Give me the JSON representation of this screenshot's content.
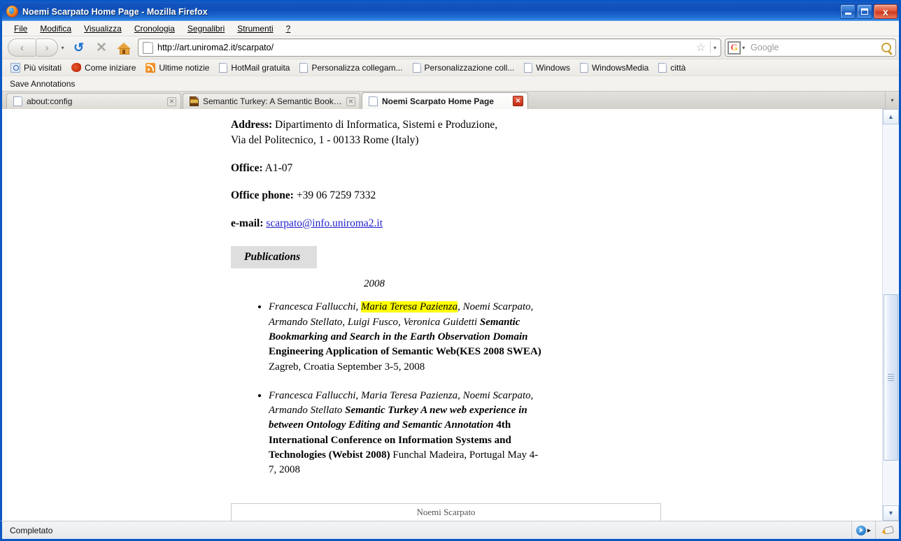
{
  "window": {
    "title": "Noemi Scarpato Home Page - Mozilla Firefox",
    "minimize_label": "Minimize",
    "maximize_label": "Maximize",
    "close_label": "x"
  },
  "menubar": [
    {
      "label": "File"
    },
    {
      "label": "Modifica"
    },
    {
      "label": "Visualizza"
    },
    {
      "label": "Cronologia"
    },
    {
      "label": "Segnalibri"
    },
    {
      "label": "Strumenti"
    },
    {
      "label": "?"
    }
  ],
  "navbar": {
    "back_label": "‹",
    "forward_label": "›",
    "history_dropdown_label": "▾",
    "reload_label": "↻",
    "stop_label": "✕",
    "home_label": "Home",
    "url": "http://art.uniroma2.it/scarpato/",
    "bookmark_star_label": "☆",
    "url_dropdown_label": "▾",
    "search_engine_label": "G",
    "search_engine_dropdown_label": "▾",
    "search_placeholder": "Google",
    "search_value": "",
    "search_go_label": "Search"
  },
  "bookmarks": [
    {
      "label": "Più visitati",
      "icon": "search-page-icon"
    },
    {
      "label": "Come iniziare",
      "icon": "firefox-icon"
    },
    {
      "label": "Ultime notizie",
      "icon": "rss-icon"
    },
    {
      "label": "HotMail gratuita",
      "icon": "page-icon"
    },
    {
      "label": "Personalizza collegam...",
      "icon": "page-icon"
    },
    {
      "label": "Personalizzazione coll...",
      "icon": "page-icon"
    },
    {
      "label": "Windows",
      "icon": "page-icon"
    },
    {
      "label": "WindowsMedia",
      "icon": "page-icon"
    },
    {
      "label": "città",
      "icon": "page-icon"
    }
  ],
  "annotation_toolbar": {
    "save_annotations_label": "Save Annotations"
  },
  "tabs": {
    "items": [
      {
        "label": "about:config",
        "favicon": "page-icon",
        "active": false,
        "close_label": "✕"
      },
      {
        "label": "Semantic Turkey: A Semantic Bookmark...",
        "favicon": "turkey-icon",
        "active": false,
        "close_label": "✕"
      },
      {
        "label": "Noemi Scarpato Home Page",
        "favicon": "page-icon",
        "active": true,
        "close_label": "✕"
      }
    ],
    "list_all_label": "▾"
  },
  "page": {
    "contact": [
      {
        "label": "Address:",
        "value": "Dipartimento di Informatica, Sistemi e Produzione,",
        "value2": "Via del Politecnico, 1 - 00133 Rome (Italy)"
      },
      {
        "label": "Office:",
        "value": "A1-07"
      },
      {
        "label": "Office phone:",
        "value": "+39 06 7259 7332"
      }
    ],
    "email": {
      "label": "e-mail:",
      "address": "scarpato@info.uniroma2.it"
    },
    "publications_header": "Publications",
    "year": "2008",
    "publications": [
      {
        "authors_before": "Francesca Fallucchi, ",
        "highlighted_author": "Maria Teresa Pazienza",
        "authors_after": ", Noemi Scarpato, Armando Stellato, Luigi Fusco, Veronica Guidetti ",
        "title": "Semantic Bookmarking and Search in the Earth Observation Domain",
        "venue": " Engineering Application of Semantic Web(KES 2008 SWEA)",
        "location": " Zagreb, Croatia September 3-5, 2008"
      },
      {
        "authors_before": "Francesca Fallucchi, Maria Teresa Pazienza, Noemi Scarpato, Armando Stellato ",
        "highlighted_author": "",
        "authors_after": "",
        "title": "Semantic Turkey A new web experience in between Ontology Editing and Semantic Annotation",
        "venue": " 4th International Conference on Information Systems and Technologies (Webist 2008)",
        "location": " Funchal Madeira, Portugal May 4-7, 2008"
      }
    ],
    "footer": "Noemi Scarpato"
  },
  "scrollbar": {
    "up_label": "▲",
    "down_label": "▼"
  },
  "statusbar": {
    "text": "Completato",
    "annotation_icon_label": "semantic-annotation",
    "highlighter_icon_label": "highlighter"
  },
  "colors": {
    "titlebar_blue": "#0f4fba",
    "highlight_yellow": "#ffff00",
    "link_blue": "#2222cc",
    "pub_header_bg": "#dedede"
  }
}
